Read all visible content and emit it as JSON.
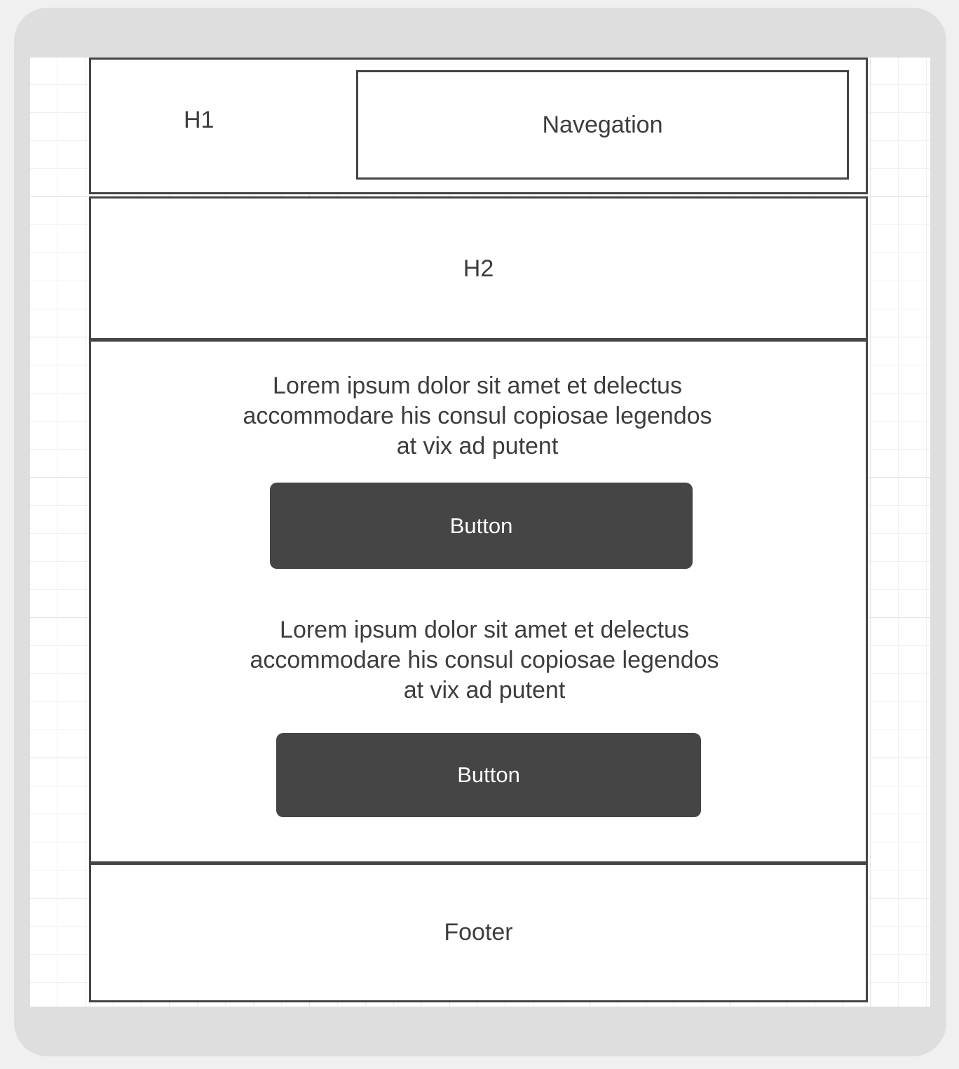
{
  "header": {
    "h1_label": "H1",
    "navigation_label": "Navegation"
  },
  "hero": {
    "h2_label": "H2"
  },
  "main": {
    "sections": [
      {
        "text": "Lorem ipsum dolor sit amet et delectus accommodare his consul copiosae legendos at vix ad putent",
        "button_label": "Button"
      },
      {
        "text": "Lorem ipsum dolor sit amet et delectus accommodare his consul copiosae legendos at vix ad putent",
        "button_label": "Button"
      }
    ]
  },
  "footer": {
    "label": "Footer"
  },
  "colors": {
    "frame": "#dedede",
    "border": "#454545",
    "button_bg": "#454545",
    "button_text": "#ffffff",
    "text": "#3d3d3d"
  }
}
